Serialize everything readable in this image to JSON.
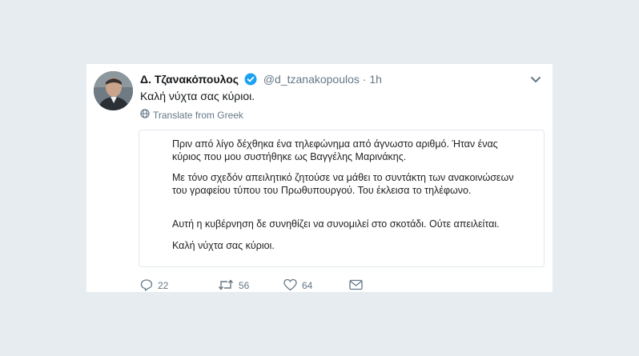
{
  "tweet": {
    "author_name": "Δ. Τζανακόπουλος",
    "handle": "@d_tzanakopoulos",
    "separator": "·",
    "time": "1h",
    "text": "Καλή νύχτα σας κύριοι.",
    "translate_label": "Translate from Greek"
  },
  "image_text": {
    "p1": "Πριν από λίγο δέχθηκα ένα τηλεφώνημα από άγνωστο αριθμό. Ήταν ένας κύριος που μου συστήθηκε ως Βαγγέλης Μαρινάκης.",
    "p2": "Με τόνο σχεδόν απειλητικό ζητούσε να μάθει το συντάκτη των ανακοινώσεων του γραφείου τύπου του Πρωθυπουργού. Του έκλεισα το τηλέφωνο.",
    "p3": "Αυτή η κυβέρνηση δε συνηθίζει να συνομιλεί στο σκοτάδι. Ούτε απειλείται.",
    "p4": "Καλή νύχτα σας κύριοι."
  },
  "actions": {
    "reply_count": "22",
    "retweet_count": "56",
    "like_count": "64"
  },
  "colors": {
    "background": "#e6ecf0",
    "verified": "#1da1f2",
    "muted": "#657786"
  },
  "icons": [
    "verified-badge-icon",
    "chevron-down-icon",
    "globe-icon",
    "reply-icon",
    "retweet-icon",
    "like-icon",
    "message-icon"
  ]
}
